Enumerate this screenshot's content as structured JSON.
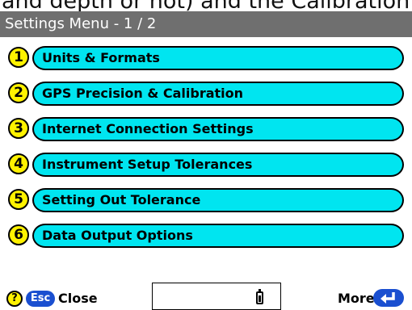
{
  "header": {
    "caption": "and depth or not) and the Calibration",
    "title": "Settings Menu - 1 / 2"
  },
  "menu": {
    "items": [
      {
        "number": "1",
        "label": "Units & Formats"
      },
      {
        "number": "2",
        "label": "GPS Precision & Calibration"
      },
      {
        "number": "3",
        "label": "Internet Connection Settings"
      },
      {
        "number": "4",
        "label": "Instrument Setup Tolerances"
      },
      {
        "number": "5",
        "label": "Setting Out Tolerance"
      },
      {
        "number": "6",
        "label": "Data Output Options"
      }
    ]
  },
  "footer": {
    "help_symbol": "?",
    "esc_label": "Esc",
    "close_label": "Close",
    "more_label": "More"
  },
  "icons": {
    "help": "help-icon",
    "battery": "battery-icon",
    "enter": "enter-arrow-icon"
  },
  "colors": {
    "title_bar": "#6f6f6f",
    "number_badge": "#fff200",
    "pill": "#00e5f0",
    "button_blue": "#1a4fd0"
  }
}
